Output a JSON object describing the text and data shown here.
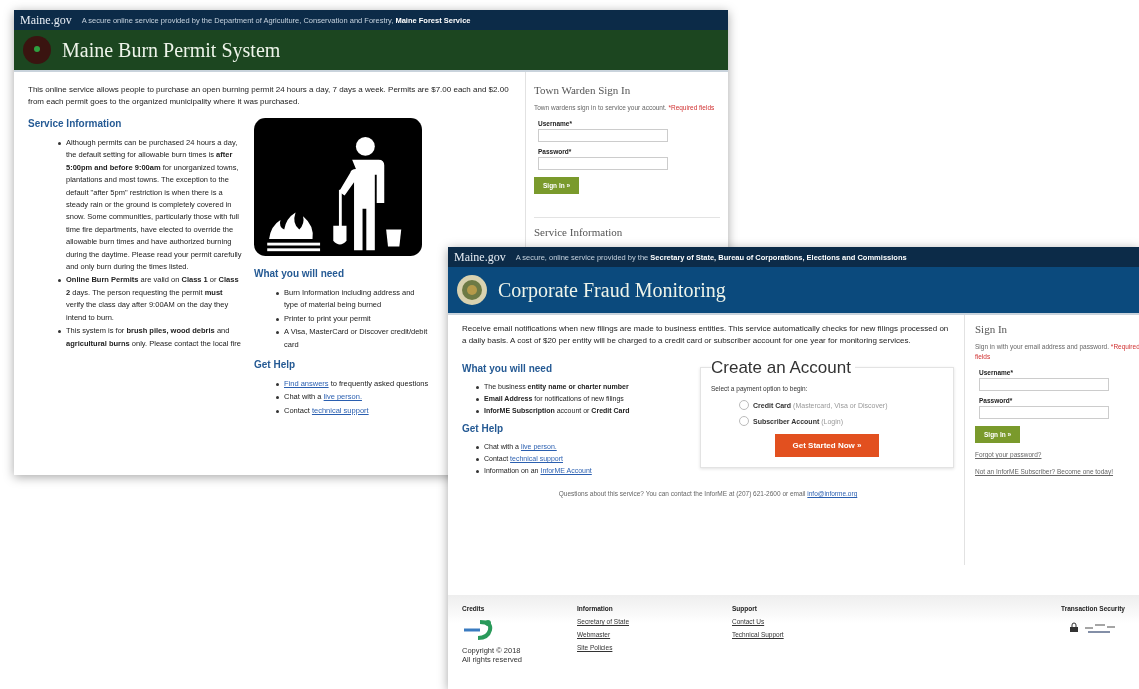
{
  "burn_permit_page": {
    "topbar": {
      "logo": "Maine.gov",
      "tagline": "A secure online service provided by the Department of Agriculture, Conservation and Forestry, **Maine Forest Service**"
    },
    "title": "Maine Burn Permit System",
    "intro": "This online service allows people to purchase an open burning permit 24 hours a day, 7 days a week. Permits are $7.00 each and $2.00 from each permit goes to the organized municipality where it was purchased.",
    "service_info": {
      "heading": "Service Information",
      "items": [
        "Although permits can be purchased 24 hours a day, the default setting for allowable burn times is **after 5:00pm and before 9:00am** for unorganized towns, plantations and most towns. The exception to the default \"after 5pm\" restriction is when there is a steady rain or the ground is completely covered in snow. Some communities, particularly those with full time fire departments, have elected to override the allowable burn times and have authorized burning during the daytime. Please read your permit carefully and only burn during the times listed.",
        "**Online Burn Permits** are valid on **Class 1** or **Class 2** days. The person requesting the permit **must** verify the class day after 9:00AM on the day they intend to burn.",
        "This system is for **brush piles, wood debris** and **agricultural burns** only. Please contact the local fire"
      ]
    },
    "needs": {
      "heading": "What you will need",
      "items": [
        "Burn Information including address and type of material being burned",
        "Printer to print your permit",
        "A Visa, MasterCard or Discover credit/debit card"
      ]
    },
    "help": {
      "heading": "Get Help",
      "items": [
        {
          "link": "Find answers",
          "after": " to frequently asked questions"
        },
        {
          "before": "Chat with a ",
          "link": "live person."
        },
        {
          "before": "Contact ",
          "link": "technical support"
        }
      ]
    },
    "sign_in": {
      "title": "Town Warden Sign In",
      "hint": "Town wardens sign in to service your account. ",
      "required": "*Required fields",
      "fields": [
        {
          "label": "Username*"
        },
        {
          "label": "Password*"
        }
      ],
      "button": "Sign In »",
      "next_heading": "Service Information"
    }
  },
  "fraud_monitoring_page": {
    "topbar": {
      "logo": "Maine.gov",
      "tagline": "A secure, online service provided by the **Secretary of State, Bureau of Corporations, Elections and Commissions**"
    },
    "title": "Corporate Fraud Monitoring",
    "intro": "Receive email notifications when new filings are made to business entities. This service automatically checks for new filings processed on a daily basis. A cost of $20 per entity will be charged to a credit card or subscriber account for one year for monitoring services.",
    "needs": {
      "heading": "What you will need",
      "items": [
        "The business **entity name or charter number**",
        "**Email Address** for notifications of new filings",
        "**InforME Subscription** account or **Credit Card**"
      ]
    },
    "help": {
      "heading": "Get Help",
      "items": [
        {
          "before": "Chat with a ",
          "link": "live person."
        },
        {
          "before": "Contact ",
          "link": "technical support"
        },
        {
          "before": "Information on an ",
          "link": "InforME Account"
        }
      ]
    },
    "create_account": {
      "title": "Create an Account",
      "prompt": "Select a payment option to begin:",
      "options": [
        {
          "label": "Credit Card",
          "note": "(Mastercard, Visa or Discover)",
          "selected": false
        },
        {
          "label": "Subscriber Account",
          "note": "(Login)",
          "selected": false
        }
      ],
      "button": "Get Started Now »"
    },
    "sign_in": {
      "title": "Sign In",
      "hint": "Sign in with your email address and password. ",
      "required": "*Required fields",
      "fields": [
        {
          "label": "Username*"
        },
        {
          "label": "Password*"
        }
      ],
      "button": "Sign In »",
      "links": [
        "Forgot your password?",
        "Not an InforME Subscriber? Become one today!"
      ]
    },
    "contact": {
      "before": "Questions about this service? You can contact the InforME at (207) 621-2600 or email ",
      "link": "info@informe.org"
    },
    "footer": {
      "credits": {
        "heading": "Credits",
        "copyright": "Copyright © 2018\nAll rights reserved"
      },
      "information": {
        "heading": "Information",
        "links": [
          "Secretary of State",
          "Webmaster",
          "Site Policies"
        ]
      },
      "support": {
        "heading": "Support",
        "links": [
          "Contact Us",
          "Technical Support"
        ]
      },
      "security": {
        "heading": "Transaction Security"
      }
    }
  }
}
